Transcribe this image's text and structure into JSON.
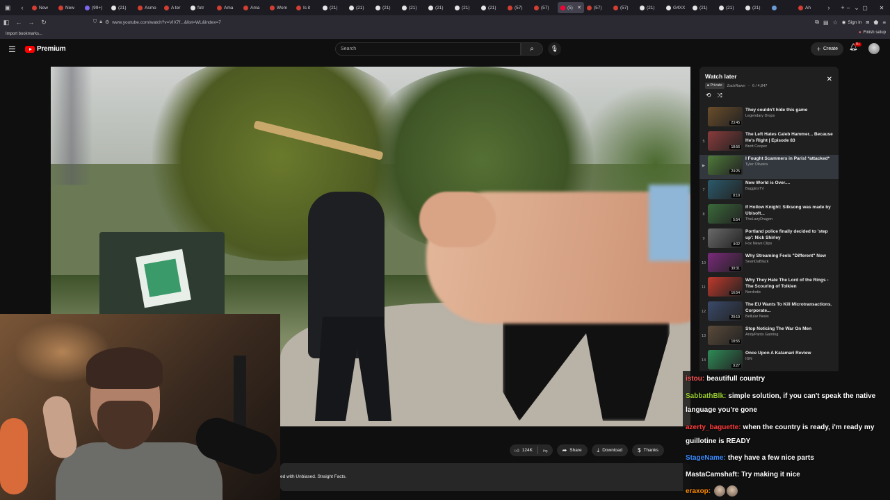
{
  "browser": {
    "tabs": [
      {
        "label": "New",
        "color": "#d23f31"
      },
      {
        "label": "New",
        "color": "#d23f31"
      },
      {
        "label": "(99+)",
        "color": "#7b68ee"
      },
      {
        "label": "(21)",
        "color": "#e5e5e5"
      },
      {
        "label": "Asmo",
        "color": "#d23f31"
      },
      {
        "label": "A ter",
        "color": "#d23f31"
      },
      {
        "label": "fotr",
        "color": "#e5e5e5"
      },
      {
        "label": "Ama",
        "color": "#d23f31"
      },
      {
        "label": "Ama",
        "color": "#d23f31"
      },
      {
        "label": "Wom",
        "color": "#d23f31"
      },
      {
        "label": "Is it",
        "color": "#d23f31"
      },
      {
        "label": "(21)",
        "color": "#e5e5e5"
      },
      {
        "label": "(21)",
        "color": "#e5e5e5"
      },
      {
        "label": "(21)",
        "color": "#e5e5e5"
      },
      {
        "label": "(21)",
        "color": "#e5e5e5"
      },
      {
        "label": "(21)",
        "color": "#e5e5e5"
      },
      {
        "label": "(21)",
        "color": "#e5e5e5"
      },
      {
        "label": "(21)",
        "color": "#e5e5e5"
      },
      {
        "label": "(57)",
        "color": "#d23f31"
      },
      {
        "label": "(57)",
        "color": "#d23f31"
      },
      {
        "label": "(5)",
        "color": "#ff0033",
        "active": true
      },
      {
        "label": "(57)",
        "color": "#d23f31"
      },
      {
        "label": "(57)",
        "color": "#d23f31"
      },
      {
        "label": "(21)",
        "color": "#e5e5e5"
      },
      {
        "label": "G4XX",
        "color": "#e5e5e5"
      },
      {
        "label": "(21)",
        "color": "#e5e5e5"
      },
      {
        "label": "(21)",
        "color": "#e5e5e5"
      },
      {
        "label": "(21)",
        "color": "#e5e5e5"
      },
      {
        "label": "",
        "color": "#6b9bd2"
      },
      {
        "label": "Ah",
        "color": "#d23f31"
      }
    ],
    "url": "www.youtube.com/watch?v=VIX7f...&list=WL&index=7",
    "sign_in": "Sign in",
    "import_bookmarks": "Import bookmarks...",
    "finish_setup": "Finish setup"
  },
  "youtube": {
    "logo": "Premium",
    "search_placeholder": "Search",
    "create": "Create",
    "notifications": "9+"
  },
  "video_actions": {
    "likes": "124K",
    "share": "Share",
    "download": "Download",
    "thanks": "Thanks"
  },
  "description_snippet": "ed with Unbiased. Straight Facts.",
  "playlist": {
    "title": "Watch later",
    "privacy": "Private",
    "owner": "ZackRawrr",
    "position": "6 / 4,847",
    "items": [
      {
        "index": "",
        "title": "They couldn't hide this game",
        "channel": "Legendary Drops",
        "duration": "23:45",
        "thumb": "#6a4d2a"
      },
      {
        "index": "5",
        "title": "The Left Hates Caleb Hammer... Because He's Right | Episode 83",
        "channel": "Brett Cooper",
        "duration": "18:56",
        "thumb": "#8a3b3b"
      },
      {
        "index": "",
        "title": "I Fought Scammers in Paris! *attacked*",
        "channel": "Tyler Oliveira",
        "duration": "24:25",
        "thumb": "#4f7a3a",
        "current": true
      },
      {
        "index": "7",
        "title": "New World is Over....",
        "channel": "BagginsTV",
        "duration": "8:19",
        "thumb": "#2b5a6b"
      },
      {
        "index": "8",
        "title": "If Hollow Knight: Silksong was made by Ubisoft...",
        "channel": "TheLazyDragon",
        "duration": "5:54",
        "thumb": "#3a6a3a"
      },
      {
        "index": "9",
        "title": "Portland police finally decided to 'step up': Nick Shirley",
        "channel": "Fox News Clips",
        "duration": "4:02",
        "thumb": "#6a6a6a"
      },
      {
        "index": "10",
        "title": "Why Streaming Feels \"Different\" Now",
        "channel": "SeanDaBlack",
        "duration": "39:31",
        "thumb": "#7a2a7a"
      },
      {
        "index": "11",
        "title": "Why They Hate The Lord of the Rings - The Scouring of Tolkien",
        "channel": "Nerdrotic",
        "duration": "16:54",
        "thumb": "#c0392b"
      },
      {
        "index": "12",
        "title": "The EU Wants To Kill Microtransactions. Corporate...",
        "channel": "Bellular News",
        "duration": "20:19",
        "thumb": "#3a4a6a"
      },
      {
        "index": "13",
        "title": "Stop Noticing The War On Men",
        "channel": "AndyPants Gaming",
        "duration": "18:55",
        "thumb": "#5a4a3a"
      },
      {
        "index": "14",
        "title": "Once Upon A Katamari Review",
        "channel": "IGN",
        "duration": "9:27",
        "thumb": "#2e8b57"
      }
    ]
  },
  "chat": [
    {
      "user": "istou:",
      "color": "#ff5a5a",
      "text": "beautifull country"
    },
    {
      "user": "SabbathBlk:",
      "color": "#9acd32",
      "text": "simple solution, if you can't speak the native language you're gone"
    },
    {
      "user": "azerty_baguette:",
      "color": "#ff3c3c",
      "text": "when the country is ready, i'm ready my guillotine is READY"
    },
    {
      "user": "StageName:",
      "color": "#3c8cff",
      "text": "they have a few nice parts"
    },
    {
      "user": "MastaCamshaft:",
      "color": "#ffffff",
      "text": "Try making it nice"
    },
    {
      "user": "eraxop:",
      "color": "#ff8c00",
      "text": ""
    }
  ]
}
